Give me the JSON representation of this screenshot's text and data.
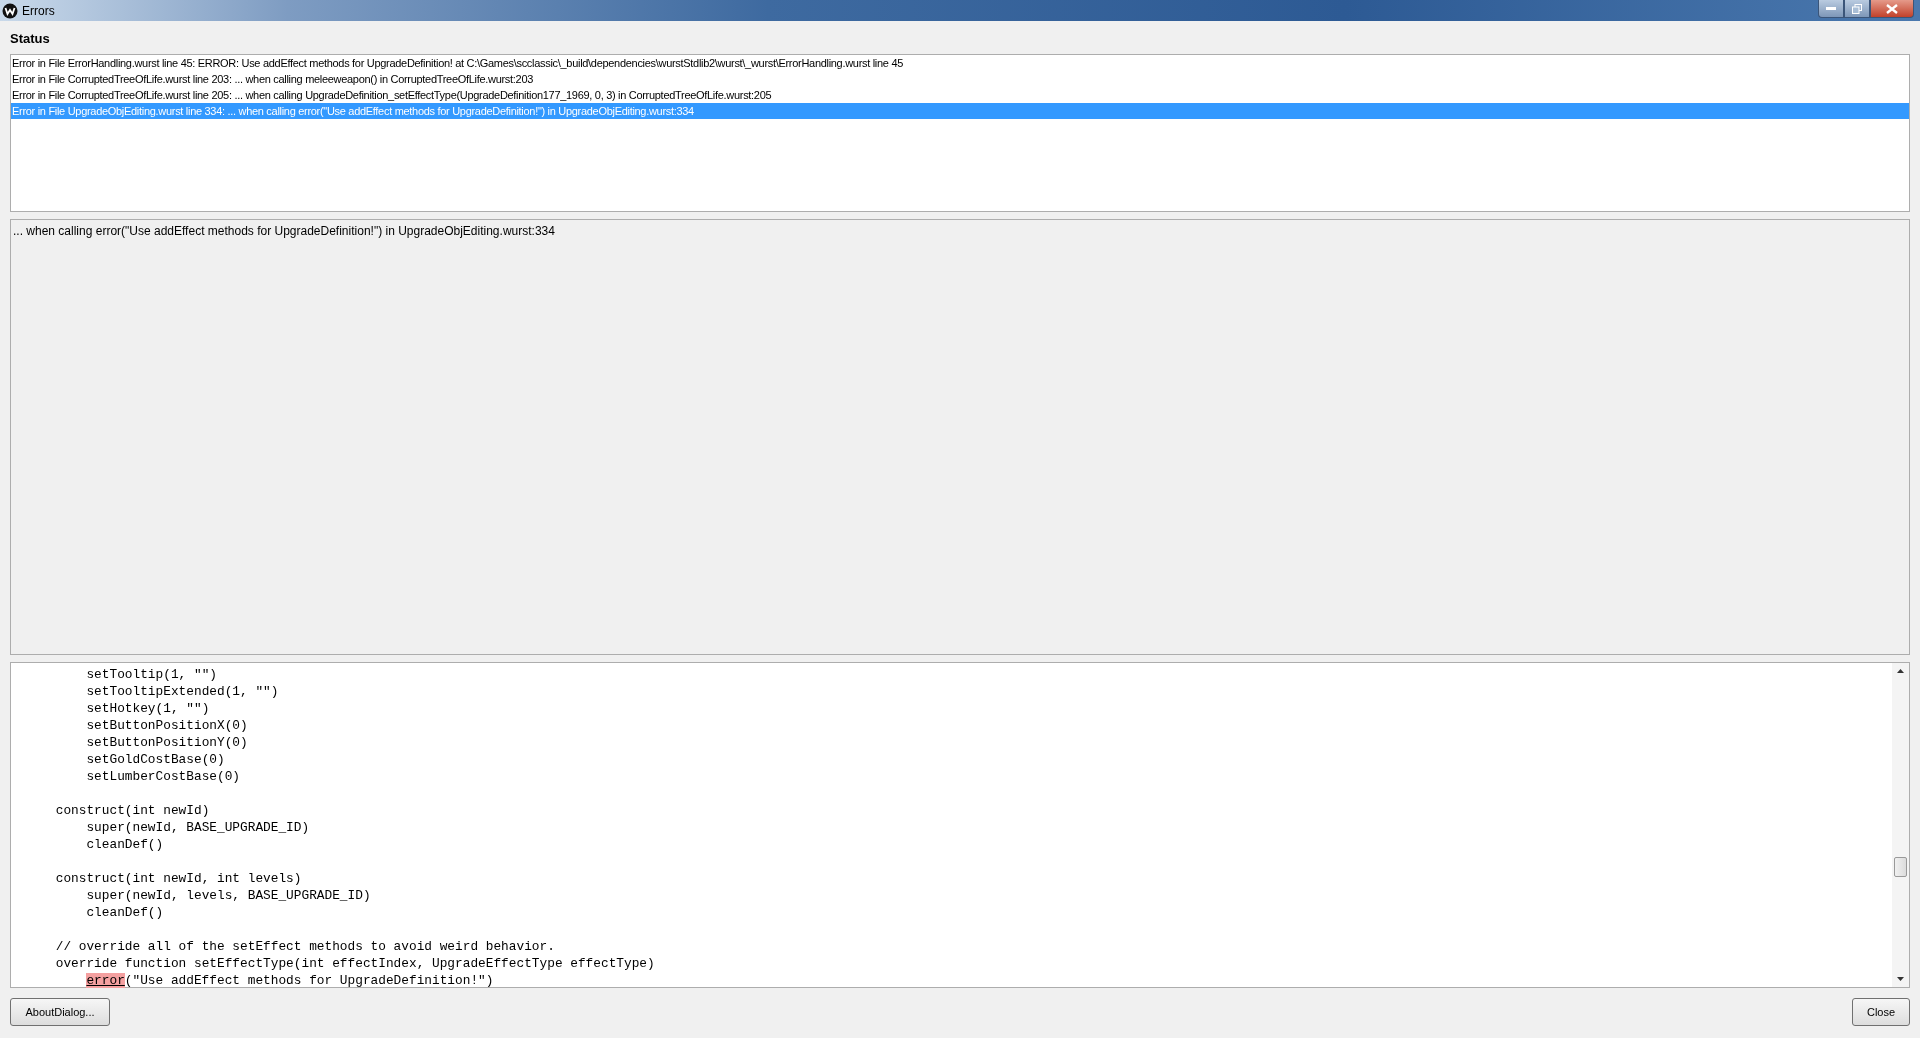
{
  "window": {
    "title": "Errors"
  },
  "status_label": "Status",
  "errors": [
    {
      "text": "Error in File ErrorHandling.wurst line 45: ERROR: Use addEffect methods for UpgradeDefinition!  at C:\\Games\\scclassic\\_build\\dependencies\\wurstStdlib2\\wurst\\_wurst\\ErrorHandling.wurst line 45",
      "selected": false
    },
    {
      "text": "Error in File CorruptedTreeOfLife.wurst line 203: ... when calling meleeweapon() in CorruptedTreeOfLife.wurst:203",
      "selected": false
    },
    {
      "text": "Error in File CorruptedTreeOfLife.wurst line 205: ... when calling UpgradeDefinition_setEffectType(UpgradeDefinition177_1969, 0, 3) in CorruptedTreeOfLife.wurst:205",
      "selected": false
    },
    {
      "text": "Error in File UpgradeObjEditing.wurst line 334: ... when calling error(\"Use addEffect methods for UpgradeDefinition!\") in UpgradeObjEditing.wurst:334",
      "selected": true
    }
  ],
  "detail": "... when calling error(\"Use addEffect methods for UpgradeDefinition!\") in UpgradeObjEditing.wurst:334",
  "code_lines": [
    {
      "kind": "code",
      "segments": [
        {
          "text": "        setTooltip(1, \"\")",
          "kind": "plain"
        }
      ]
    },
    {
      "kind": "code",
      "segments": [
        {
          "text": "        setTooltipExtended(1, \"\")",
          "kind": "plain"
        }
      ]
    },
    {
      "kind": "code",
      "segments": [
        {
          "text": "        setHotkey(1, \"\")",
          "kind": "plain"
        }
      ]
    },
    {
      "kind": "code",
      "segments": [
        {
          "text": "        setButtonPositionX(0)",
          "kind": "plain"
        }
      ]
    },
    {
      "kind": "code",
      "segments": [
        {
          "text": "        setButtonPositionY(0)",
          "kind": "plain"
        }
      ]
    },
    {
      "kind": "code",
      "segments": [
        {
          "text": "        setGoldCostBase(0)",
          "kind": "plain"
        }
      ]
    },
    {
      "kind": "code",
      "segments": [
        {
          "text": "        setLumberCostBase(0)",
          "kind": "plain"
        }
      ]
    },
    {
      "kind": "blank"
    },
    {
      "kind": "code",
      "segments": [
        {
          "text": "    construct(int newId)",
          "kind": "plain"
        }
      ]
    },
    {
      "kind": "code",
      "segments": [
        {
          "text": "        super(newId, BASE_UPGRADE_ID)",
          "kind": "plain"
        }
      ]
    },
    {
      "kind": "code",
      "segments": [
        {
          "text": "        cleanDef()",
          "kind": "plain"
        }
      ]
    },
    {
      "kind": "blank"
    },
    {
      "kind": "code",
      "segments": [
        {
          "text": "    construct(int newId, int levels)",
          "kind": "plain"
        }
      ]
    },
    {
      "kind": "code",
      "segments": [
        {
          "text": "        super(newId, levels, BASE_UPGRADE_ID)",
          "kind": "plain"
        }
      ]
    },
    {
      "kind": "code",
      "segments": [
        {
          "text": "        cleanDef()",
          "kind": "plain"
        }
      ]
    },
    {
      "kind": "blank"
    },
    {
      "kind": "code",
      "segments": [
        {
          "text": "    // override all of the setEffect methods to avoid weird behavior.",
          "kind": "plain"
        }
      ]
    },
    {
      "kind": "code",
      "segments": [
        {
          "text": "    override function setEffectType(int effectIndex, UpgradeEffectType effectType)",
          "kind": "plain"
        }
      ]
    },
    {
      "kind": "code_indented",
      "segments": [
        {
          "text": "error",
          "kind": "error"
        },
        {
          "text": "(\"Use addEffect methods for UpgradeDefinition!\")",
          "kind": "plain"
        }
      ]
    }
  ],
  "buttons": {
    "left": "AboutDialog...",
    "right": "Close"
  }
}
